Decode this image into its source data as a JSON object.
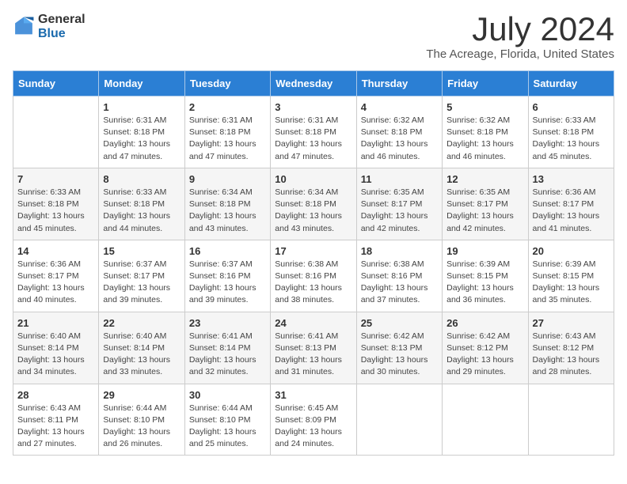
{
  "header": {
    "logo_general": "General",
    "logo_blue": "Blue",
    "month_title": "July 2024",
    "location": "The Acreage, Florida, United States"
  },
  "weekdays": [
    "Sunday",
    "Monday",
    "Tuesday",
    "Wednesday",
    "Thursday",
    "Friday",
    "Saturday"
  ],
  "weeks": [
    [
      {
        "day": "",
        "sunrise": "",
        "sunset": "",
        "daylight": ""
      },
      {
        "day": "1",
        "sunrise": "Sunrise: 6:31 AM",
        "sunset": "Sunset: 8:18 PM",
        "daylight": "Daylight: 13 hours and 47 minutes."
      },
      {
        "day": "2",
        "sunrise": "Sunrise: 6:31 AM",
        "sunset": "Sunset: 8:18 PM",
        "daylight": "Daylight: 13 hours and 47 minutes."
      },
      {
        "day": "3",
        "sunrise": "Sunrise: 6:31 AM",
        "sunset": "Sunset: 8:18 PM",
        "daylight": "Daylight: 13 hours and 47 minutes."
      },
      {
        "day": "4",
        "sunrise": "Sunrise: 6:32 AM",
        "sunset": "Sunset: 8:18 PM",
        "daylight": "Daylight: 13 hours and 46 minutes."
      },
      {
        "day": "5",
        "sunrise": "Sunrise: 6:32 AM",
        "sunset": "Sunset: 8:18 PM",
        "daylight": "Daylight: 13 hours and 46 minutes."
      },
      {
        "day": "6",
        "sunrise": "Sunrise: 6:33 AM",
        "sunset": "Sunset: 8:18 PM",
        "daylight": "Daylight: 13 hours and 45 minutes."
      }
    ],
    [
      {
        "day": "7",
        "sunrise": "Sunrise: 6:33 AM",
        "sunset": "Sunset: 8:18 PM",
        "daylight": "Daylight: 13 hours and 45 minutes."
      },
      {
        "day": "8",
        "sunrise": "Sunrise: 6:33 AM",
        "sunset": "Sunset: 8:18 PM",
        "daylight": "Daylight: 13 hours and 44 minutes."
      },
      {
        "day": "9",
        "sunrise": "Sunrise: 6:34 AM",
        "sunset": "Sunset: 8:18 PM",
        "daylight": "Daylight: 13 hours and 43 minutes."
      },
      {
        "day": "10",
        "sunrise": "Sunrise: 6:34 AM",
        "sunset": "Sunset: 8:18 PM",
        "daylight": "Daylight: 13 hours and 43 minutes."
      },
      {
        "day": "11",
        "sunrise": "Sunrise: 6:35 AM",
        "sunset": "Sunset: 8:17 PM",
        "daylight": "Daylight: 13 hours and 42 minutes."
      },
      {
        "day": "12",
        "sunrise": "Sunrise: 6:35 AM",
        "sunset": "Sunset: 8:17 PM",
        "daylight": "Daylight: 13 hours and 42 minutes."
      },
      {
        "day": "13",
        "sunrise": "Sunrise: 6:36 AM",
        "sunset": "Sunset: 8:17 PM",
        "daylight": "Daylight: 13 hours and 41 minutes."
      }
    ],
    [
      {
        "day": "14",
        "sunrise": "Sunrise: 6:36 AM",
        "sunset": "Sunset: 8:17 PM",
        "daylight": "Daylight: 13 hours and 40 minutes."
      },
      {
        "day": "15",
        "sunrise": "Sunrise: 6:37 AM",
        "sunset": "Sunset: 8:17 PM",
        "daylight": "Daylight: 13 hours and 39 minutes."
      },
      {
        "day": "16",
        "sunrise": "Sunrise: 6:37 AM",
        "sunset": "Sunset: 8:16 PM",
        "daylight": "Daylight: 13 hours and 39 minutes."
      },
      {
        "day": "17",
        "sunrise": "Sunrise: 6:38 AM",
        "sunset": "Sunset: 8:16 PM",
        "daylight": "Daylight: 13 hours and 38 minutes."
      },
      {
        "day": "18",
        "sunrise": "Sunrise: 6:38 AM",
        "sunset": "Sunset: 8:16 PM",
        "daylight": "Daylight: 13 hours and 37 minutes."
      },
      {
        "day": "19",
        "sunrise": "Sunrise: 6:39 AM",
        "sunset": "Sunset: 8:15 PM",
        "daylight": "Daylight: 13 hours and 36 minutes."
      },
      {
        "day": "20",
        "sunrise": "Sunrise: 6:39 AM",
        "sunset": "Sunset: 8:15 PM",
        "daylight": "Daylight: 13 hours and 35 minutes."
      }
    ],
    [
      {
        "day": "21",
        "sunrise": "Sunrise: 6:40 AM",
        "sunset": "Sunset: 8:14 PM",
        "daylight": "Daylight: 13 hours and 34 minutes."
      },
      {
        "day": "22",
        "sunrise": "Sunrise: 6:40 AM",
        "sunset": "Sunset: 8:14 PM",
        "daylight": "Daylight: 13 hours and 33 minutes."
      },
      {
        "day": "23",
        "sunrise": "Sunrise: 6:41 AM",
        "sunset": "Sunset: 8:14 PM",
        "daylight": "Daylight: 13 hours and 32 minutes."
      },
      {
        "day": "24",
        "sunrise": "Sunrise: 6:41 AM",
        "sunset": "Sunset: 8:13 PM",
        "daylight": "Daylight: 13 hours and 31 minutes."
      },
      {
        "day": "25",
        "sunrise": "Sunrise: 6:42 AM",
        "sunset": "Sunset: 8:13 PM",
        "daylight": "Daylight: 13 hours and 30 minutes."
      },
      {
        "day": "26",
        "sunrise": "Sunrise: 6:42 AM",
        "sunset": "Sunset: 8:12 PM",
        "daylight": "Daylight: 13 hours and 29 minutes."
      },
      {
        "day": "27",
        "sunrise": "Sunrise: 6:43 AM",
        "sunset": "Sunset: 8:12 PM",
        "daylight": "Daylight: 13 hours and 28 minutes."
      }
    ],
    [
      {
        "day": "28",
        "sunrise": "Sunrise: 6:43 AM",
        "sunset": "Sunset: 8:11 PM",
        "daylight": "Daylight: 13 hours and 27 minutes."
      },
      {
        "day": "29",
        "sunrise": "Sunrise: 6:44 AM",
        "sunset": "Sunset: 8:10 PM",
        "daylight": "Daylight: 13 hours and 26 minutes."
      },
      {
        "day": "30",
        "sunrise": "Sunrise: 6:44 AM",
        "sunset": "Sunset: 8:10 PM",
        "daylight": "Daylight: 13 hours and 25 minutes."
      },
      {
        "day": "31",
        "sunrise": "Sunrise: 6:45 AM",
        "sunset": "Sunset: 8:09 PM",
        "daylight": "Daylight: 13 hours and 24 minutes."
      },
      {
        "day": "",
        "sunrise": "",
        "sunset": "",
        "daylight": ""
      },
      {
        "day": "",
        "sunrise": "",
        "sunset": "",
        "daylight": ""
      },
      {
        "day": "",
        "sunrise": "",
        "sunset": "",
        "daylight": ""
      }
    ]
  ]
}
